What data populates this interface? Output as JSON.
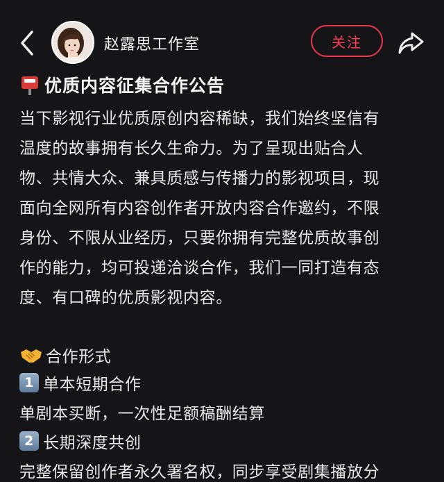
{
  "header": {
    "author_name": "赵露思工作室",
    "follow_label": "关注"
  },
  "post": {
    "title": "优质内容征集合作公告",
    "intro_lines": [
      "当下影视行业优质原创内容稀缺，我们始终坚信有",
      "温度的故事拥有长久生命力。为了呈现出贴合人",
      "物、共情大众、兼具质感与传播力的影视项目，现",
      "面向全网所有内容创作者开放内容合作邀约，不限",
      "身份、不限从业经历，只要你拥有完整优质故事创",
      "作的能力，均可投递洽谈合作，我们一同打造有态",
      "度、有口碑的优质影视内容。"
    ],
    "section_title": "合作形式",
    "items": [
      {
        "number": "1",
        "title": "单本短期合作",
        "description": "单剧本买断，一次性足额稿酬结算"
      },
      {
        "number": "2",
        "title": "长期深度共创",
        "description": "完整保留创作者永久署名权，同步享受剧集播放分"
      }
    ]
  },
  "icons": {
    "back": "chevron-left-icon",
    "share": "share-arrow-icon",
    "title": "mailbox-icon",
    "section": "handshake-icon"
  },
  "colors": {
    "background": "#151518",
    "accent": "#e8364f",
    "text": "#e8e8e8"
  }
}
